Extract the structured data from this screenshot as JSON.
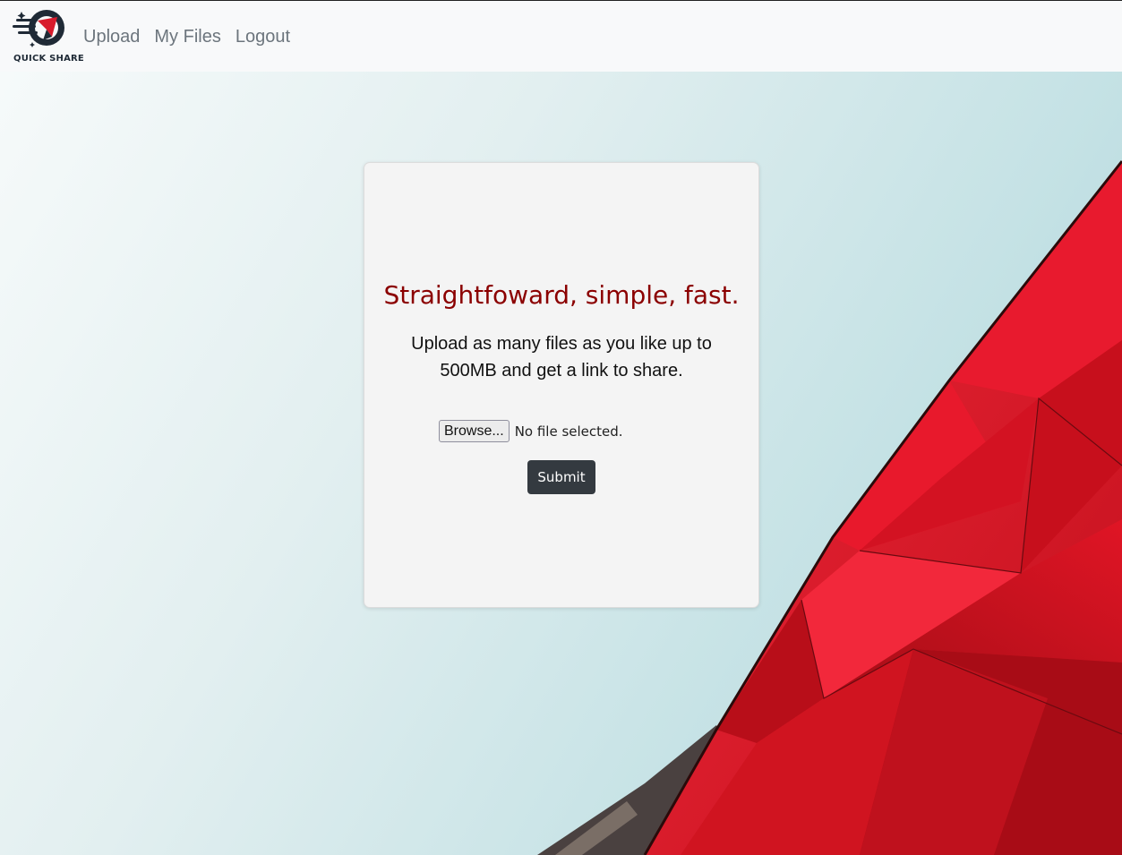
{
  "brand": {
    "name": "QUICK SHARE",
    "icon": "rocket-logo-icon"
  },
  "nav": {
    "upload": "Upload",
    "my_files": "My Files",
    "logout": "Logout"
  },
  "card": {
    "headline": "Straightfoward, simple, fast.",
    "description": "Upload as many files as you like up to 500MB and get a link to share.",
    "browse_label": "Browse...",
    "file_status": "No file selected.",
    "submit_label": "Submit"
  },
  "colors": {
    "headline": "#8b0000",
    "submit_bg": "#343a40",
    "navbar_bg": "#f8f9fa",
    "accent_red": "#e0121f"
  }
}
